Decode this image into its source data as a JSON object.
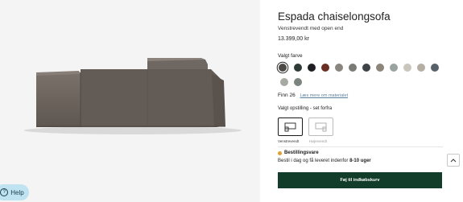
{
  "product": {
    "title": "Espada chaiselongsofa",
    "variant": "Venstrevendt med open end",
    "price": "13.399,00 kr"
  },
  "color": {
    "label": "Valgt farve",
    "swatches": [
      {
        "hex": "#4c4a47",
        "selected": true
      },
      {
        "hex": "#2f3b37"
      },
      {
        "hex": "#1d1f22"
      },
      {
        "hex": "#6b2e24"
      },
      {
        "hex": "#8a8581"
      },
      {
        "hex": "#7a7b77"
      },
      {
        "hex": "#3d4346"
      },
      {
        "hex": "#8e857a"
      },
      {
        "hex": "#9aa3a0"
      },
      {
        "hex": "#c9c6bd"
      },
      {
        "hex": "#b5afa3"
      },
      {
        "hex": "#56616a"
      },
      {
        "hex": "#a7aaa3"
      },
      {
        "hex": "#7c847f"
      },
      {
        "hex": "#5e6266"
      }
    ]
  },
  "fabric": {
    "name": "Finn 26",
    "link": "Læs mere om materialet"
  },
  "setup": {
    "label": "Valgt opstilling - set forfra",
    "options": [
      {
        "label": "Venstrevendt",
        "selected": true
      },
      {
        "label": "Højrevendt",
        "selected": false
      }
    ]
  },
  "stock": {
    "status": "Bestillingsvare",
    "status_color": "#e0a032",
    "delivery_prefix": "Bestil i dag og få leveret indenfor",
    "delivery_weeks": "8-10 uger"
  },
  "cta": {
    "label": "Føj til indkøbskurv",
    "color": "#123d2a"
  },
  "help": {
    "label": "Help"
  },
  "icons": {
    "scroll": "chevron-up-icon",
    "help": "question-circle-icon"
  }
}
